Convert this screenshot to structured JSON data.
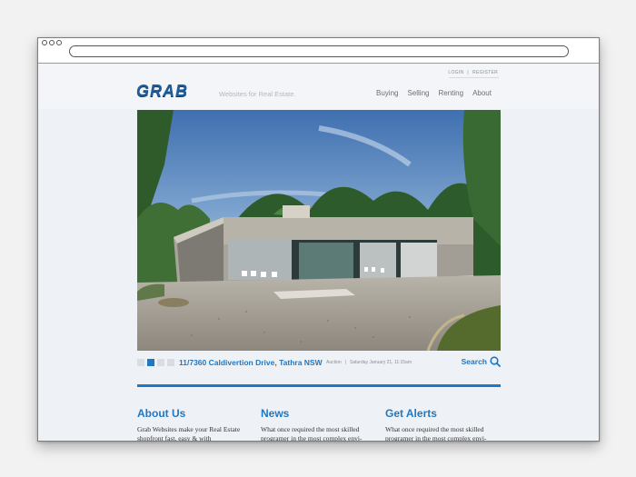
{
  "header": {
    "top_links": {
      "login": "LOGIN",
      "separator": "|",
      "register": "REGISTER"
    },
    "logo_text": "GRAB",
    "tagline": "Websites for Real Estate.",
    "nav": [
      "Buying",
      "Selling",
      "Renting",
      "About"
    ]
  },
  "hero": {
    "image": "modern-glass-concrete-house-photo"
  },
  "listing": {
    "pager_count": 4,
    "pager_active": 2,
    "address": "11/7360 Caldivertion Drive, Tathra NSW",
    "type": "Auction",
    "separator": "|",
    "date": "Saturday January 21, 11:15am",
    "search_label": "Search"
  },
  "columns": [
    {
      "title": "About Us",
      "text": "Grab Websites make your Real Estate shopfront fast, easy & with"
    },
    {
      "title": "News",
      "text": "What once required the most skilled programer in the most complex envi-"
    },
    {
      "title": "Get Alerts",
      "text": "What once required the most skilled programer in the most complex envi-"
    }
  ],
  "colors": {
    "accent": "#1f78c3",
    "logo": "#1f5d9b"
  }
}
